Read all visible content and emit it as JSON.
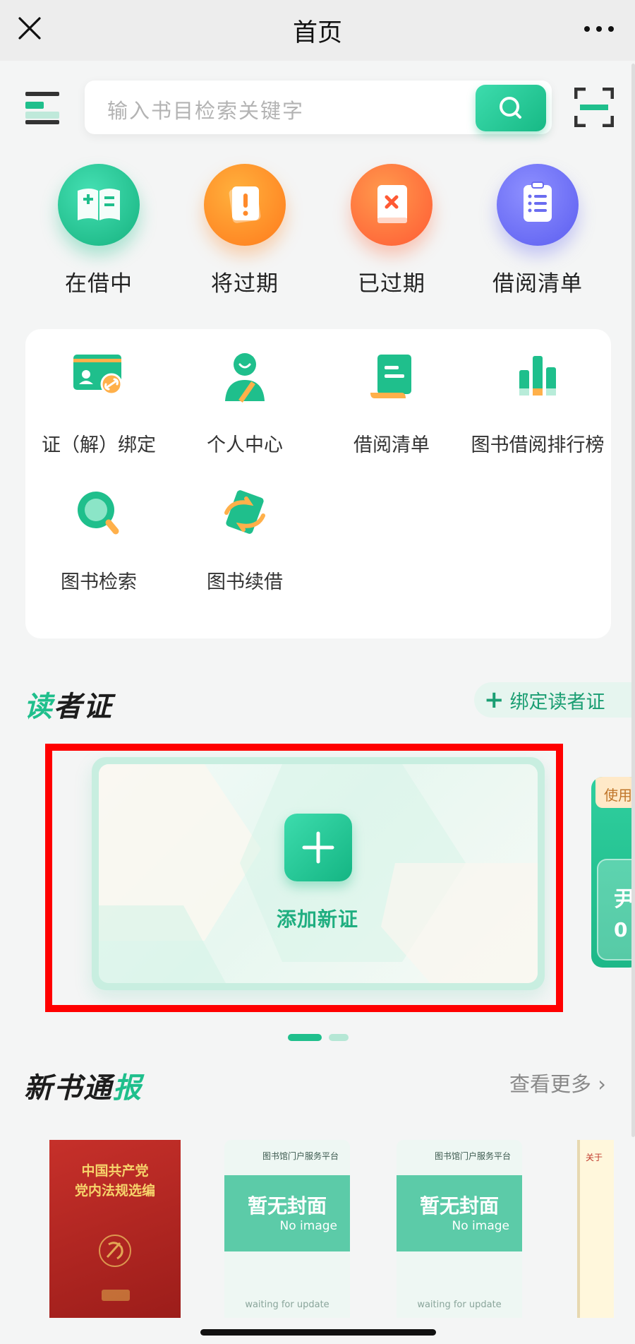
{
  "nav": {
    "title": "首页",
    "close_icon": "close-icon",
    "more_icon": "more-icon"
  },
  "search": {
    "placeholder": "输入书目检索关键字",
    "button_icon": "search-icon"
  },
  "quick_actions": [
    {
      "label": "在借中",
      "icon": "open-book-icon",
      "color": "#1fbf8c"
    },
    {
      "label": "将过期",
      "icon": "warning-book-icon",
      "color": "#ff8a2a"
    },
    {
      "label": "已过期",
      "icon": "expired-book-icon",
      "color": "#ff6a3d"
    },
    {
      "label": "借阅清单",
      "icon": "clipboard-list-icon",
      "color": "#6a6cf0"
    }
  ],
  "services": [
    {
      "label": "证（解）绑定",
      "icon": "card-link-icon"
    },
    {
      "label": "个人中心",
      "icon": "user-icon"
    },
    {
      "label": "借阅清单",
      "icon": "scroll-list-icon"
    },
    {
      "label": "图书借阅排行榜",
      "icon": "bar-chart-icon"
    },
    {
      "label": "图书检索",
      "icon": "magnifier-icon"
    },
    {
      "label": "图书续借",
      "icon": "renew-book-icon"
    }
  ],
  "reader_card": {
    "title_accent": "读",
    "title_rest": "者证",
    "bind_label": "绑定读者证",
    "add_label": "添加新证",
    "peek_tag": "使用",
    "peek_line1": "尹",
    "peek_line2": "0"
  },
  "new_books": {
    "title_part1": "新书通",
    "title_accent": "报",
    "more_label": "查看更多",
    "books": [
      {
        "type": "cover",
        "title_line1": "中国共产党",
        "title_line2": "党内法规选编"
      },
      {
        "type": "placeholder",
        "head": "图书馆门户服务平台",
        "cn": "暂无封面",
        "en": "No image",
        "wait": "waiting for update"
      },
      {
        "type": "placeholder",
        "head": "图书馆门户服务平台",
        "cn": "暂无封面",
        "en": "No image",
        "wait": "waiting for update"
      },
      {
        "type": "edge",
        "title": "关于"
      }
    ]
  },
  "colors": {
    "accent": "#1fbf8c",
    "highlight": "#ff0000"
  }
}
